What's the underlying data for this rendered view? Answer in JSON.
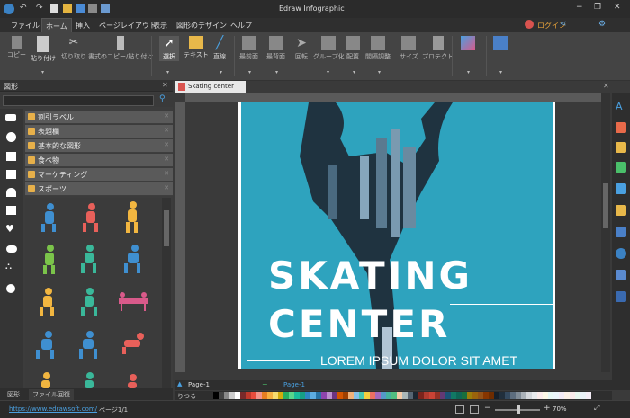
{
  "app": {
    "title": "Edraw Infographic",
    "login": "ログイン"
  },
  "menu": [
    "ファイル",
    "ホーム",
    "挿入",
    "ページレイアウト",
    "表示",
    "図形のデザイン",
    "ヘルプ"
  ],
  "ribbon": {
    "clipboard": [
      "コピー",
      "貼り付け",
      "切り取り",
      "書式のコピー/貼り付け"
    ],
    "tools": [
      "選択",
      "テキスト",
      "直線"
    ],
    "arrange": [
      "最前面",
      "最背面",
      "回転",
      "グループ化",
      "配置",
      "間隔調整",
      "サイズ",
      "プロテクト"
    ]
  },
  "library": {
    "title": "図形",
    "categories": [
      "割引ラベル",
      "表題欄",
      "基本的な図形",
      "食べ物",
      "マーケティング",
      "スポーツ"
    ],
    "tabs": [
      "図形",
      "ファイル回復"
    ]
  },
  "document": {
    "tab": "Skating center"
  },
  "poster": {
    "title1": "SKATING",
    "title2": "CENTER",
    "tagline": "LOREM IPSUM DOLOR SIT AMET",
    "bg_color": "#2ea3be"
  },
  "pages": {
    "tab1": "Page-1",
    "tab2": "Page-1"
  },
  "colorbar": {
    "label": "りつる"
  },
  "status": {
    "url": "https://www.edrawsoft.com/",
    "page": "ページ1/1",
    "zoom": "70%"
  }
}
